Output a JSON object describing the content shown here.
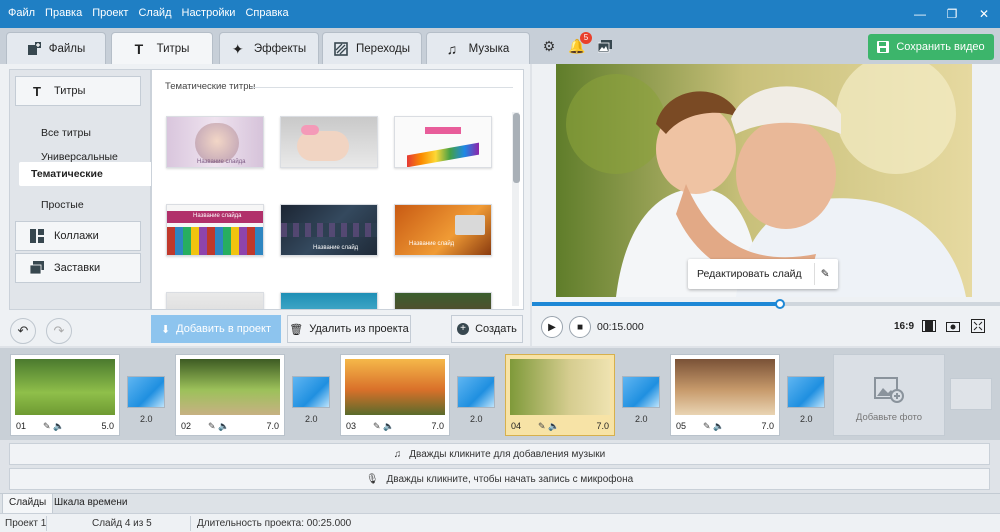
{
  "menu": [
    "Файл",
    "Правка",
    "Проект",
    "Слайд",
    "Настройки",
    "Справка"
  ],
  "window_controls": {
    "minimize": "—",
    "maximize": "❐",
    "close": "✕"
  },
  "tabs": [
    {
      "label": "Файлы",
      "icon": "add-file-icon"
    },
    {
      "label": "Титры",
      "icon": "text-t-icon",
      "active": true
    },
    {
      "label": "Эффекты",
      "icon": "star-icon"
    },
    {
      "label": "Переходы",
      "icon": "transition-icon"
    },
    {
      "label": "Музыка",
      "icon": "music-note-icon"
    }
  ],
  "toolbar": {
    "notification_count": "5",
    "save_label": "Сохранить видео"
  },
  "titles_panel": {
    "category_main": "Титры",
    "subitems": [
      "Все титры",
      "Универсальные",
      "Тематические",
      "Простые"
    ],
    "selected_subitem": "Тематические",
    "category_collages": "Коллажи",
    "category_intros": "Заставки",
    "gallery_title": "Тематические титры",
    "thumb_label": "Название слайда",
    "thumb_label_small": "Название слайд"
  },
  "actions": {
    "add_to_project": "Добавить в проект",
    "remove_from_project": "Удалить из проекта",
    "create": "Создать"
  },
  "preview": {
    "edit_slide": "Редактировать слайд",
    "time": "00:15.000",
    "aspect_ratio": "16:9",
    "progress": 0.53
  },
  "slides": [
    {
      "num": "01",
      "duration": "5.0"
    },
    {
      "num": "02",
      "duration": "7.0"
    },
    {
      "num": "03",
      "duration": "7.0"
    },
    {
      "num": "04",
      "duration": "7.0",
      "selected": true
    },
    {
      "num": "05",
      "duration": "7.0"
    }
  ],
  "transitions": [
    "2.0",
    "2.0",
    "2.0",
    "2.0",
    "2.0"
  ],
  "add_photo_label": "Добавьте фото",
  "music_hint": "Дважды кликните для добавления музыки",
  "mic_hint": "Дважды кликните, чтобы начать запись с микрофона",
  "bottom_tabs": [
    "Слайды",
    "Шкала времени"
  ],
  "status": {
    "project": "Проект 1",
    "slide_info": "Слайд 4 из 5",
    "duration": "Длительность проекта: 00:25.000"
  },
  "colors": {
    "titlebar": "#1f7fc4",
    "save_button": "#3cb56b",
    "accent": "#1e88d6",
    "selected_slide": "#f7e3a6"
  }
}
